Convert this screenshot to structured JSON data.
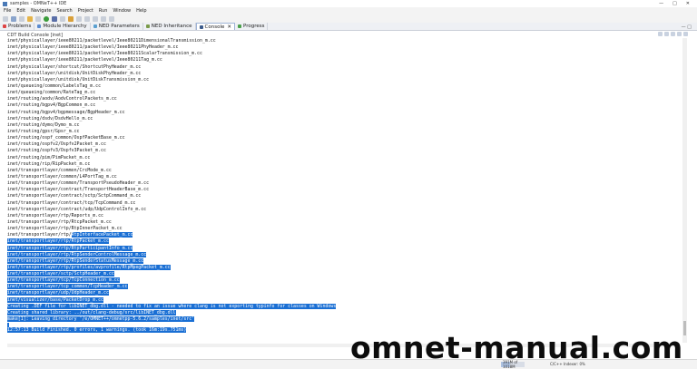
{
  "window": {
    "title": "samples - OMNeT++ IDE"
  },
  "menu": [
    "File",
    "Edit",
    "Navigate",
    "Search",
    "Project",
    "Run",
    "Window",
    "Help"
  ],
  "tabs": [
    {
      "label": "Problems",
      "active": false
    },
    {
      "label": "Module Hierarchy",
      "active": false
    },
    {
      "label": "NED Parameters",
      "active": false
    },
    {
      "label": "NED Inheritance",
      "active": false
    },
    {
      "label": "Console",
      "active": true
    },
    {
      "label": "Progress",
      "active": false
    }
  ],
  "console": {
    "title": "CDT Build Console [inet]",
    "lines": [
      {
        "text": "inet/physicallayer/ieee80211/packetlevel/Ieee80211DimensionalTransmission_m.cc",
        "selected": false
      },
      {
        "text": "inet/physicallayer/ieee80211/packetlevel/Ieee80211PhyHeader_m.cc",
        "selected": false
      },
      {
        "text": "inet/physicallayer/ieee80211/packetlevel/Ieee80211ScalarTransmission_m.cc",
        "selected": false
      },
      {
        "text": "inet/physicallayer/ieee80211/packetlevel/Ieee80211Tag_m.cc",
        "selected": false
      },
      {
        "text": "inet/physicallayer/shortcut/ShortcutPhyHeader_m.cc",
        "selected": false
      },
      {
        "text": "inet/physicallayer/unitdisk/UnitDiskPhyHeader_m.cc",
        "selected": false
      },
      {
        "text": "inet/physicallayer/unitdisk/UnitDiskTransmission_m.cc",
        "selected": false
      },
      {
        "text": "inet/queueing/common/LabelsTag_m.cc",
        "selected": false
      },
      {
        "text": "inet/queueing/common/RateTag_m.cc",
        "selected": false
      },
      {
        "text": "inet/routing/aodv/AodvControlPackets_m.cc",
        "selected": false
      },
      {
        "text": "inet/routing/bgpv4/BgpCommon_m.cc",
        "selected": false
      },
      {
        "text": "inet/routing/bgpv4/bgpmessage/BgpHeader_m.cc",
        "selected": false
      },
      {
        "text": "inet/routing/dsdv/DsdvHello_m.cc",
        "selected": false
      },
      {
        "text": "inet/routing/dymo/Dymo_m.cc",
        "selected": false
      },
      {
        "text": "inet/routing/gpsr/Gpsr_m.cc",
        "selected": false
      },
      {
        "text": "inet/routing/ospf_common/OspfPacketBase_m.cc",
        "selected": false
      },
      {
        "text": "inet/routing/ospfv2/Ospfv2Packet_m.cc",
        "selected": false
      },
      {
        "text": "inet/routing/ospfv3/Ospfv3Packet_m.cc",
        "selected": false
      },
      {
        "text": "inet/routing/pim/PimPacket_m.cc",
        "selected": false
      },
      {
        "text": "inet/routing/rip/RipPacket_m.cc",
        "selected": false
      },
      {
        "text": "inet/transportlayer/common/CrcMode_m.cc",
        "selected": false
      },
      {
        "text": "inet/transportlayer/common/L4PortTag_m.cc",
        "selected": false
      },
      {
        "text": "inet/transportlayer/common/TransportPseudoHeader_m.cc",
        "selected": false
      },
      {
        "text": "inet/transportlayer/contract/TransportHeaderBase_m.cc",
        "selected": false
      },
      {
        "text": "inet/transportlayer/contract/sctp/SctpCommand_m.cc",
        "selected": false
      },
      {
        "text": "inet/transportlayer/contract/tcp/TcpCommand_m.cc",
        "selected": false
      },
      {
        "text": "inet/transportlayer/contract/udp/UdpControlInfo_m.cc",
        "selected": false
      },
      {
        "text": "inet/transportlayer/rtp/Reports_m.cc",
        "selected": false
      },
      {
        "text": "inet/transportlayer/rtp/RtcpPacket_m.cc",
        "selected": false
      },
      {
        "text": "inet/transportlayer/rtp/RtpInnerPacket_m.cc",
        "selected": false
      },
      {
        "text": "inet/transportlayer/rtp/",
        "selected": false,
        "tail": "RtpInterfacePacket_m.cc"
      },
      {
        "text": "inet/transportlayer/rtp/RtpPacket_m.cc",
        "selected": true
      },
      {
        "text": "inet/transportlayer/rtp/RtpParticipantInfo_m.cc",
        "selected": true
      },
      {
        "text": "inet/transportlayer/rtp/RtpSenderControlMessage_m.cc",
        "selected": true
      },
      {
        "text": "inet/transportlayer/rtp/RtpSenderStatusMessage_m.cc",
        "selected": true
      },
      {
        "text": "inet/transportlayer/rtp/profiles/avprofile/RtpMpegPacket_m.cc",
        "selected": true
      },
      {
        "text": "inet/transportlayer/sctp/SctpHeader_m.cc",
        "selected": true
      },
      {
        "text": "inet/transportlayer/tcp/TcpConnection_m.cc",
        "selected": true
      },
      {
        "text": "inet/transportlayer/tcp_common/TcpHeader_m.cc",
        "selected": true
      },
      {
        "text": "inet/transportlayer/udp/UdpHeader_m.cc",
        "selected": true
      },
      {
        "text": "inet/visualizer/base/PacketDrop_m.cc",
        "selected": true
      },
      {
        "text": "Creating .DEF file for libINET_dbg.dll - needed to fix an issue where clang is not exporting typinfo for classes on Windows",
        "selected": true
      },
      {
        "text": "Creating shared library: ../out/clang-debug/src/libINET_dbg.dll",
        "selected": true
      },
      {
        "text": "make[1]: Leaving directory '/e/OMNET++/omnetpp-5.6.2/samples/inet/src'",
        "selected": true
      },
      {
        "text": "",
        "selected": true,
        "gap": true
      },
      {
        "text": "12:57:13 Build Finished. 0 errors, 1 warnings. (took 16m:19s.751ms)",
        "selected": true
      }
    ]
  },
  "statusbar": {
    "memory": "391M of 1018M",
    "memory_fraction": 0.38,
    "language": "C/C++ Indexer: 0%"
  },
  "watermark": "omnet-manual.com"
}
